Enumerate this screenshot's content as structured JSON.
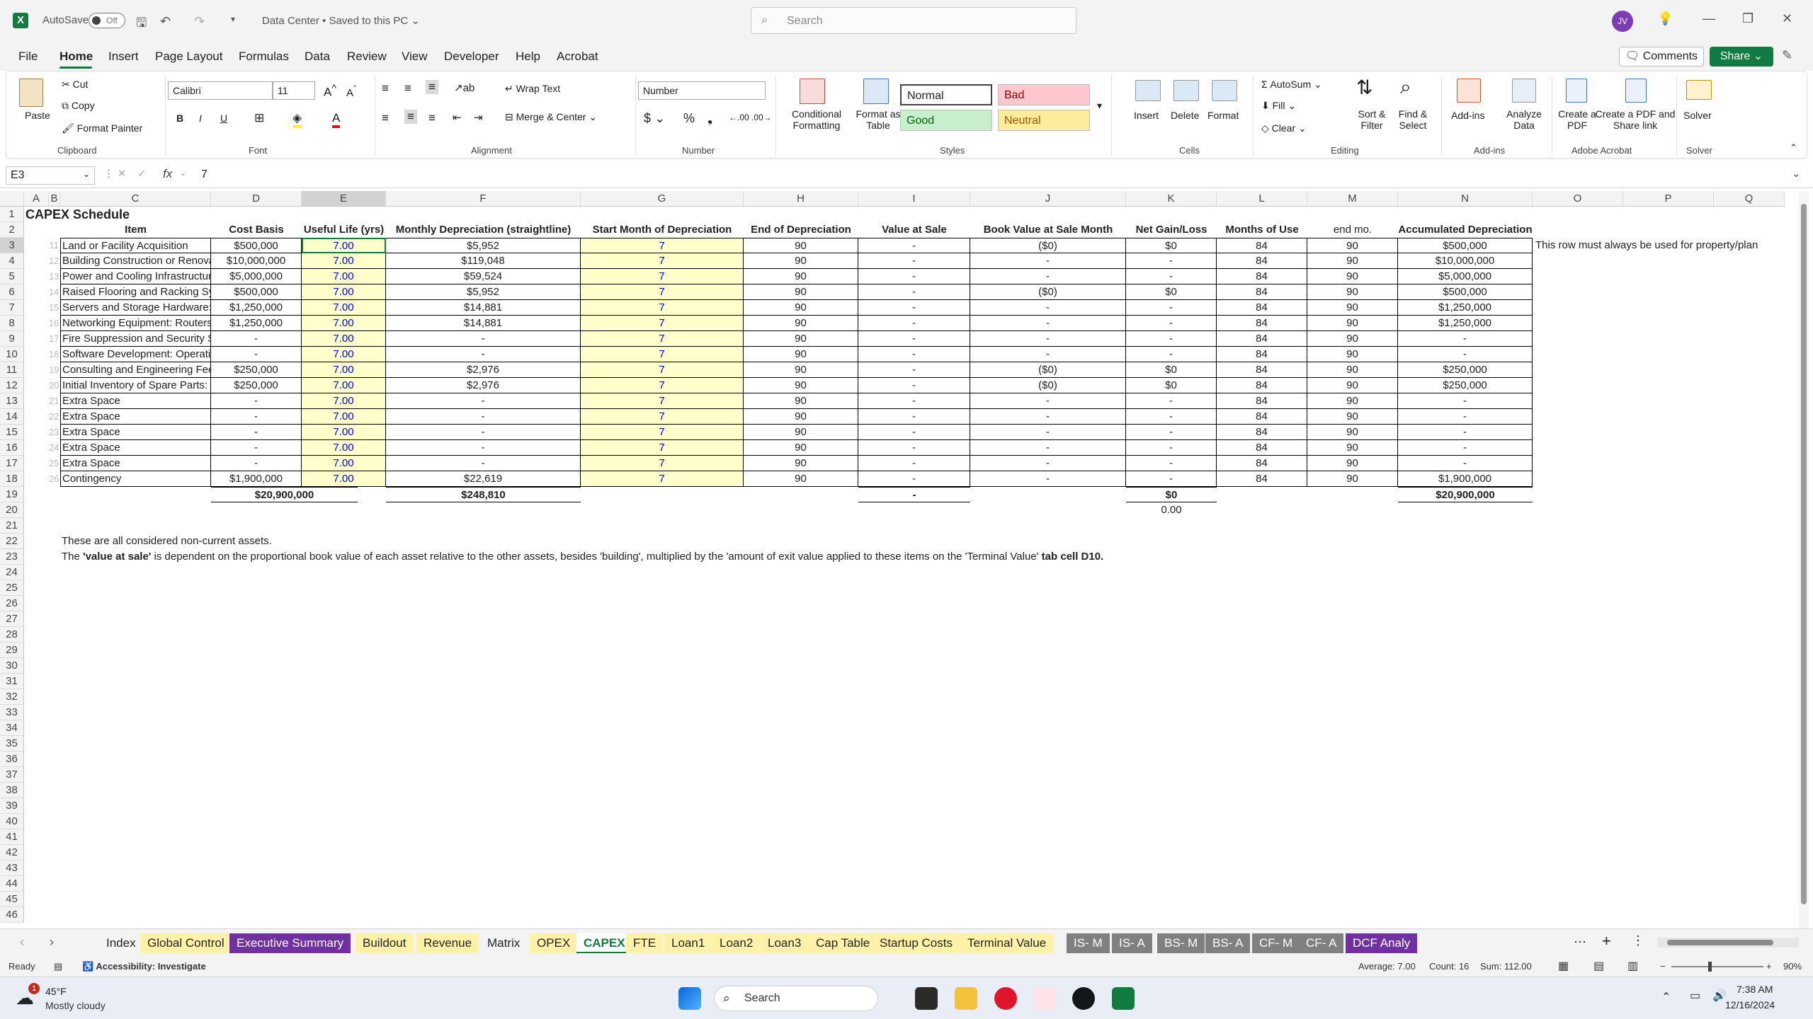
{
  "titlebar": {
    "app_logo": "X",
    "autosave_label": "AutoSave",
    "autosave_state": "Off",
    "doc_title": "Data Center • Saved to this PC ⌄",
    "search_placeholder": "Search",
    "user_initials": "JV"
  },
  "menu": {
    "items": [
      "File",
      "Home",
      "Insert",
      "Page Layout",
      "Formulas",
      "Data",
      "Review",
      "View",
      "Developer",
      "Help",
      "Acrobat"
    ],
    "active": "Home",
    "comments": "Comments",
    "share": "Share ⌄"
  },
  "ribbon": {
    "clipboard": {
      "paste": "Paste",
      "cut": "Cut",
      "copy": "Copy",
      "format_painter": "Format Painter",
      "label": "Clipboard"
    },
    "font": {
      "name": "Calibri",
      "size": "11",
      "label": "Font"
    },
    "alignment": {
      "wrap": "Wrap Text",
      "merge": "Merge & Center",
      "label": "Alignment"
    },
    "number": {
      "format": "Number",
      "label": "Number"
    },
    "styles": {
      "conditional": "Conditional Formatting",
      "format_table": "Format as Table",
      "normal": "Normal",
      "bad": "Bad",
      "good": "Good",
      "neutral": "Neutral",
      "label": "Styles"
    },
    "cells": {
      "insert": "Insert",
      "delete": "Delete",
      "format": "Format",
      "label": "Cells"
    },
    "editing": {
      "autosum": "AutoSum",
      "fill": "Fill",
      "clear": "Clear",
      "sort": "Sort & Filter",
      "find": "Find & Select",
      "label": "Editing"
    },
    "addins": {
      "addins": "Add-ins",
      "analyze": "Analyze Data",
      "label": "Add-ins"
    },
    "acrobat": {
      "create_pdf": "Create a PDF",
      "create_share": "Create a PDF and Share link",
      "label": "Adobe Acrobat"
    },
    "solver": {
      "solver": "Solver",
      "label": "Solver"
    }
  },
  "formula_bar": {
    "name_box": "E3",
    "fx": "fx",
    "value": "7"
  },
  "grid": {
    "columns": [
      "A",
      "B",
      "C",
      "D",
      "E",
      "F",
      "G",
      "H",
      "I",
      "J",
      "K",
      "L",
      "M",
      "N",
      "O",
      "P",
      "Q"
    ],
    "rows": [
      "1",
      "2",
      "3",
      "4",
      "5",
      "6",
      "7",
      "8",
      "9",
      "10",
      "11",
      "12",
      "13",
      "14",
      "15",
      "16",
      "17",
      "18",
      "19",
      "20",
      "21",
      "22",
      "23",
      "24",
      "25",
      "26",
      "27",
      "28",
      "29",
      "30",
      "31",
      "32",
      "33",
      "34",
      "35",
      "36",
      "37",
      "38",
      "39",
      "40",
      "41",
      "42",
      "43",
      "44",
      "45",
      "46"
    ],
    "title": "CAPEX Schedule",
    "headers": [
      "Item",
      "Cost Basis",
      "Useful Life (yrs)",
      "Monthly Depreciation (straightline)",
      "Start Month of Depreciation",
      "End of Depreciation",
      "Value at Sale",
      "Book Value at Sale Month",
      "Net Gain/Loss",
      "Months of Use",
      "end mo.",
      "Accumulated Depreciation"
    ],
    "data_rows": [
      {
        "b": "11",
        "item": "Land or Facility Acquisition",
        "cost": "$500,000",
        "life": "7.00",
        "monthly": "$5,952",
        "start": "7",
        "end": "90",
        "sale": "-",
        "book": "($0)",
        "gain": "$0",
        "months": "84",
        "endmo": "90",
        "accum": "$500,000"
      },
      {
        "b": "12",
        "item": "Building Construction or Renova",
        "cost": "$10,000,000",
        "life": "7.00",
        "monthly": "$119,048",
        "start": "7",
        "end": "90",
        "sale": "-",
        "book": "-",
        "gain": "-",
        "months": "84",
        "endmo": "90",
        "accum": "$10,000,000"
      },
      {
        "b": "13",
        "item": "Power and Cooling Infrastructur",
        "cost": "$5,000,000",
        "life": "7.00",
        "monthly": "$59,524",
        "start": "7",
        "end": "90",
        "sale": "-",
        "book": "-",
        "gain": "-",
        "months": "84",
        "endmo": "90",
        "accum": "$5,000,000"
      },
      {
        "b": "14",
        "item": "Raised Flooring and Racking Syst",
        "cost": "$500,000",
        "life": "7.00",
        "monthly": "$5,952",
        "start": "7",
        "end": "90",
        "sale": "-",
        "book": "($0)",
        "gain": "$0",
        "months": "84",
        "endmo": "90",
        "accum": "$500,000"
      },
      {
        "b": "15",
        "item": "Servers and Storage Hardware: T",
        "cost": "$1,250,000",
        "life": "7.00",
        "monthly": "$14,881",
        "start": "7",
        "end": "90",
        "sale": "-",
        "book": "-",
        "gain": "-",
        "months": "84",
        "endmo": "90",
        "accum": "$1,250,000"
      },
      {
        "b": "16",
        "item": "Networking Equipment: Routers",
        "cost": "$1,250,000",
        "life": "7.00",
        "monthly": "$14,881",
        "start": "7",
        "end": "90",
        "sale": "-",
        "book": "-",
        "gain": "-",
        "months": "84",
        "endmo": "90",
        "accum": "$1,250,000"
      },
      {
        "b": "17",
        "item": "Fire Suppression and Security Sy",
        "cost": "-",
        "life": "7.00",
        "monthly": "-",
        "start": "7",
        "end": "90",
        "sale": "-",
        "book": "-",
        "gain": "-",
        "months": "84",
        "endmo": "90",
        "accum": "-"
      },
      {
        "b": "18",
        "item": "Software Development: Operati",
        "cost": "-",
        "life": "7.00",
        "monthly": "-",
        "start": "7",
        "end": "90",
        "sale": "-",
        "book": "-",
        "gain": "-",
        "months": "84",
        "endmo": "90",
        "accum": "-"
      },
      {
        "b": "19",
        "item": "Consulting and Engineering Fees",
        "cost": "$250,000",
        "life": "7.00",
        "monthly": "$2,976",
        "start": "7",
        "end": "90",
        "sale": "-",
        "book": "($0)",
        "gain": "$0",
        "months": "84",
        "endmo": "90",
        "accum": "$250,000"
      },
      {
        "b": "20",
        "item": "Initial Inventory of Spare Parts: I",
        "cost": "$250,000",
        "life": "7.00",
        "monthly": "$2,976",
        "start": "7",
        "end": "90",
        "sale": "-",
        "book": "($0)",
        "gain": "$0",
        "months": "84",
        "endmo": "90",
        "accum": "$250,000"
      },
      {
        "b": "21",
        "item": "Extra Space",
        "cost": "-",
        "life": "7.00",
        "monthly": "-",
        "start": "7",
        "end": "90",
        "sale": "-",
        "book": "-",
        "gain": "-",
        "months": "84",
        "endmo": "90",
        "accum": "-"
      },
      {
        "b": "22",
        "item": "Extra Space",
        "cost": "-",
        "life": "7.00",
        "monthly": "-",
        "start": "7",
        "end": "90",
        "sale": "-",
        "book": "-",
        "gain": "-",
        "months": "84",
        "endmo": "90",
        "accum": "-"
      },
      {
        "b": "23",
        "item": "Extra Space",
        "cost": "-",
        "life": "7.00",
        "monthly": "-",
        "start": "7",
        "end": "90",
        "sale": "-",
        "book": "-",
        "gain": "-",
        "months": "84",
        "endmo": "90",
        "accum": "-"
      },
      {
        "b": "24",
        "item": "Extra Space",
        "cost": "-",
        "life": "7.00",
        "monthly": "-",
        "start": "7",
        "end": "90",
        "sale": "-",
        "book": "-",
        "gain": "-",
        "months": "84",
        "endmo": "90",
        "accum": "-"
      },
      {
        "b": "25",
        "item": "Extra Space",
        "cost": "-",
        "life": "7.00",
        "monthly": "-",
        "start": "7",
        "end": "90",
        "sale": "-",
        "book": "-",
        "gain": "-",
        "months": "84",
        "endmo": "90",
        "accum": "-"
      },
      {
        "b": "26",
        "item": "Contingency",
        "cost": "$1,900,000",
        "life": "7.00",
        "monthly": "$22,619",
        "start": "7",
        "end": "90",
        "sale": "-",
        "book": "-",
        "gain": "-",
        "months": "84",
        "endmo": "90",
        "accum": "$1,900,000"
      }
    ],
    "totals": {
      "cost": "$20,900,000",
      "monthly": "$248,810",
      "sale": "-",
      "gain": "$0",
      "accum": "$20,900,000"
    },
    "k20": "0.00",
    "side_note": "This row must always be used for property/plan",
    "note1": "These are all considered non-current assets.",
    "note2_a": "The ",
    "note2_b": "'value at sale'",
    "note2_c": " is dependent on the proportional book value of each asset relative to the other assets, besides 'building', multiplied by the 'amount of exit value applied to these items on the 'Terminal Value'",
    "note2_d": " tab cell D10."
  },
  "tabs": [
    {
      "label": "Index",
      "color": ""
    },
    {
      "label": "Global Control",
      "color": "#fff2a8"
    },
    {
      "label": "Executive Summary",
      "color": "#7030a0"
    },
    {
      "label": "Buildout",
      "color": "#fff2a8"
    },
    {
      "label": "Revenue",
      "color": "#fff2a8"
    },
    {
      "label": "Matrix",
      "color": ""
    },
    {
      "label": "OPEX",
      "color": "#fff2a8"
    },
    {
      "label": "CAPEX",
      "color": "#ffffff"
    },
    {
      "label": "FTE",
      "color": "#fff2a8"
    },
    {
      "label": "Loan1",
      "color": "#fff2a8"
    },
    {
      "label": "Loan2",
      "color": "#fff2a8"
    },
    {
      "label": "Loan3",
      "color": "#fff2a8"
    },
    {
      "label": "Cap Table",
      "color": "#fff2a8"
    },
    {
      "label": "Startup Costs",
      "color": "#fff2a8"
    },
    {
      "label": "Terminal Value",
      "color": "#fff2a8"
    },
    {
      "label": "IS- M",
      "color": "#808080"
    },
    {
      "label": "IS- A",
      "color": "#808080"
    },
    {
      "label": "BS- M",
      "color": "#808080"
    },
    {
      "label": "BS- A",
      "color": "#808080"
    },
    {
      "label": "CF- M",
      "color": "#808080"
    },
    {
      "label": "CF- A",
      "color": "#808080"
    },
    {
      "label": "DCF Analy",
      "color": "#7030a0"
    }
  ],
  "status": {
    "ready": "Ready",
    "accessibility": "Accessibility: Investigate",
    "average": "Average: 7.00",
    "count": "Count: 16",
    "sum": "Sum: 112.00",
    "zoom": "90%"
  },
  "taskbar": {
    "weather_temp": "45°F",
    "weather_desc": "Mostly cloudy",
    "weather_badge": "1",
    "search": "Search",
    "time": "7:38 AM",
    "date": "12/16/2024"
  },
  "colors": {
    "excel_green": "#107c41",
    "input_yellow": "#ffffcc",
    "input_blue": "#0000ff"
  }
}
